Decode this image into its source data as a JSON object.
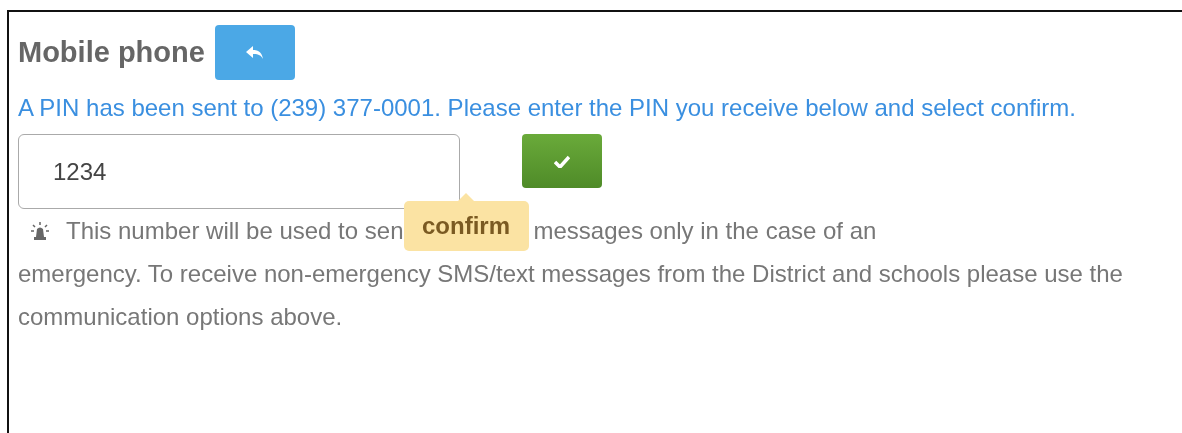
{
  "section": {
    "title": "Mobile phone"
  },
  "message": "A PIN has been sent to (239) 377-0001. Please enter the PIN you receive below and select confirm.",
  "pin_field": {
    "value": "1234"
  },
  "confirm_tooltip": "confirm",
  "notice": {
    "before_tooltip": "This number will be used to sen",
    "after_tooltip": "messages only in the case of an",
    "rest": "emergency. To receive non-emergency SMS/text messages from the District and schools please use the communication options above."
  }
}
